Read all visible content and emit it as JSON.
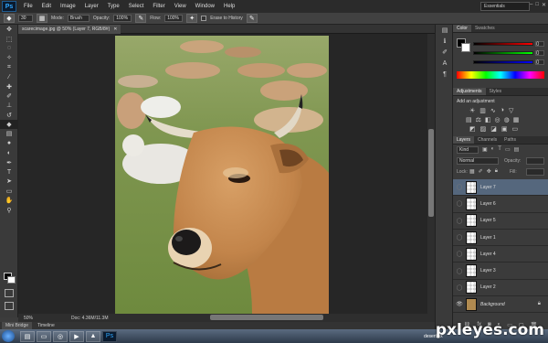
{
  "app": {
    "logo": "Ps"
  },
  "menu": [
    "File",
    "Edit",
    "Image",
    "Layer",
    "Type",
    "Select",
    "Filter",
    "View",
    "Window",
    "Help"
  ],
  "workspace": "Essentials",
  "options": {
    "mode_label": "Mode:",
    "mode_value": "Brush",
    "opacity_label": "Opacity:",
    "opacity_value": "100%",
    "flow_label": "Flow:",
    "flow_value": "100%",
    "erase_history": "Erase to History",
    "brush_size": "30"
  },
  "document": {
    "tab_title": "scarecimage.jpg @ 50% (Layer 7, RGB/8#)",
    "zoom": "50%",
    "doc_info": "Doc: 4.36M/11.3M"
  },
  "bottom_tabs": [
    "Mini Bridge",
    "Timeline"
  ],
  "color_panel": {
    "tabs": [
      "Color",
      "Swatches"
    ],
    "values": [
      "0",
      "0",
      "0"
    ]
  },
  "adjustments": {
    "tabs": [
      "Adjustments",
      "Styles"
    ],
    "heading": "Add an adjustment"
  },
  "layers_panel": {
    "tabs": [
      "Layers",
      "Channels",
      "Paths"
    ],
    "filter_kind": "Kind",
    "blend_mode": "Normal",
    "opacity_label": "Opacity:",
    "lock_label": "Lock:",
    "fill_label": "Fill:",
    "layers": [
      {
        "name": "Layer 7",
        "selected": true
      },
      {
        "name": "Layer 6",
        "selected": false
      },
      {
        "name": "Layer 5",
        "selected": false
      },
      {
        "name": "Layer 1",
        "selected": false
      },
      {
        "name": "Layer 4",
        "selected": false
      },
      {
        "name": "Layer 3",
        "selected": false
      },
      {
        "name": "Layer 2",
        "selected": false
      },
      {
        "name": "Background",
        "selected": false
      }
    ]
  },
  "taskbar": {
    "user": "desertfox"
  },
  "watermark": "pxleyes.com",
  "colors": {
    "accent_selected": "#55677d",
    "panel": "#3b3b3b",
    "document_bg": "#262626"
  }
}
